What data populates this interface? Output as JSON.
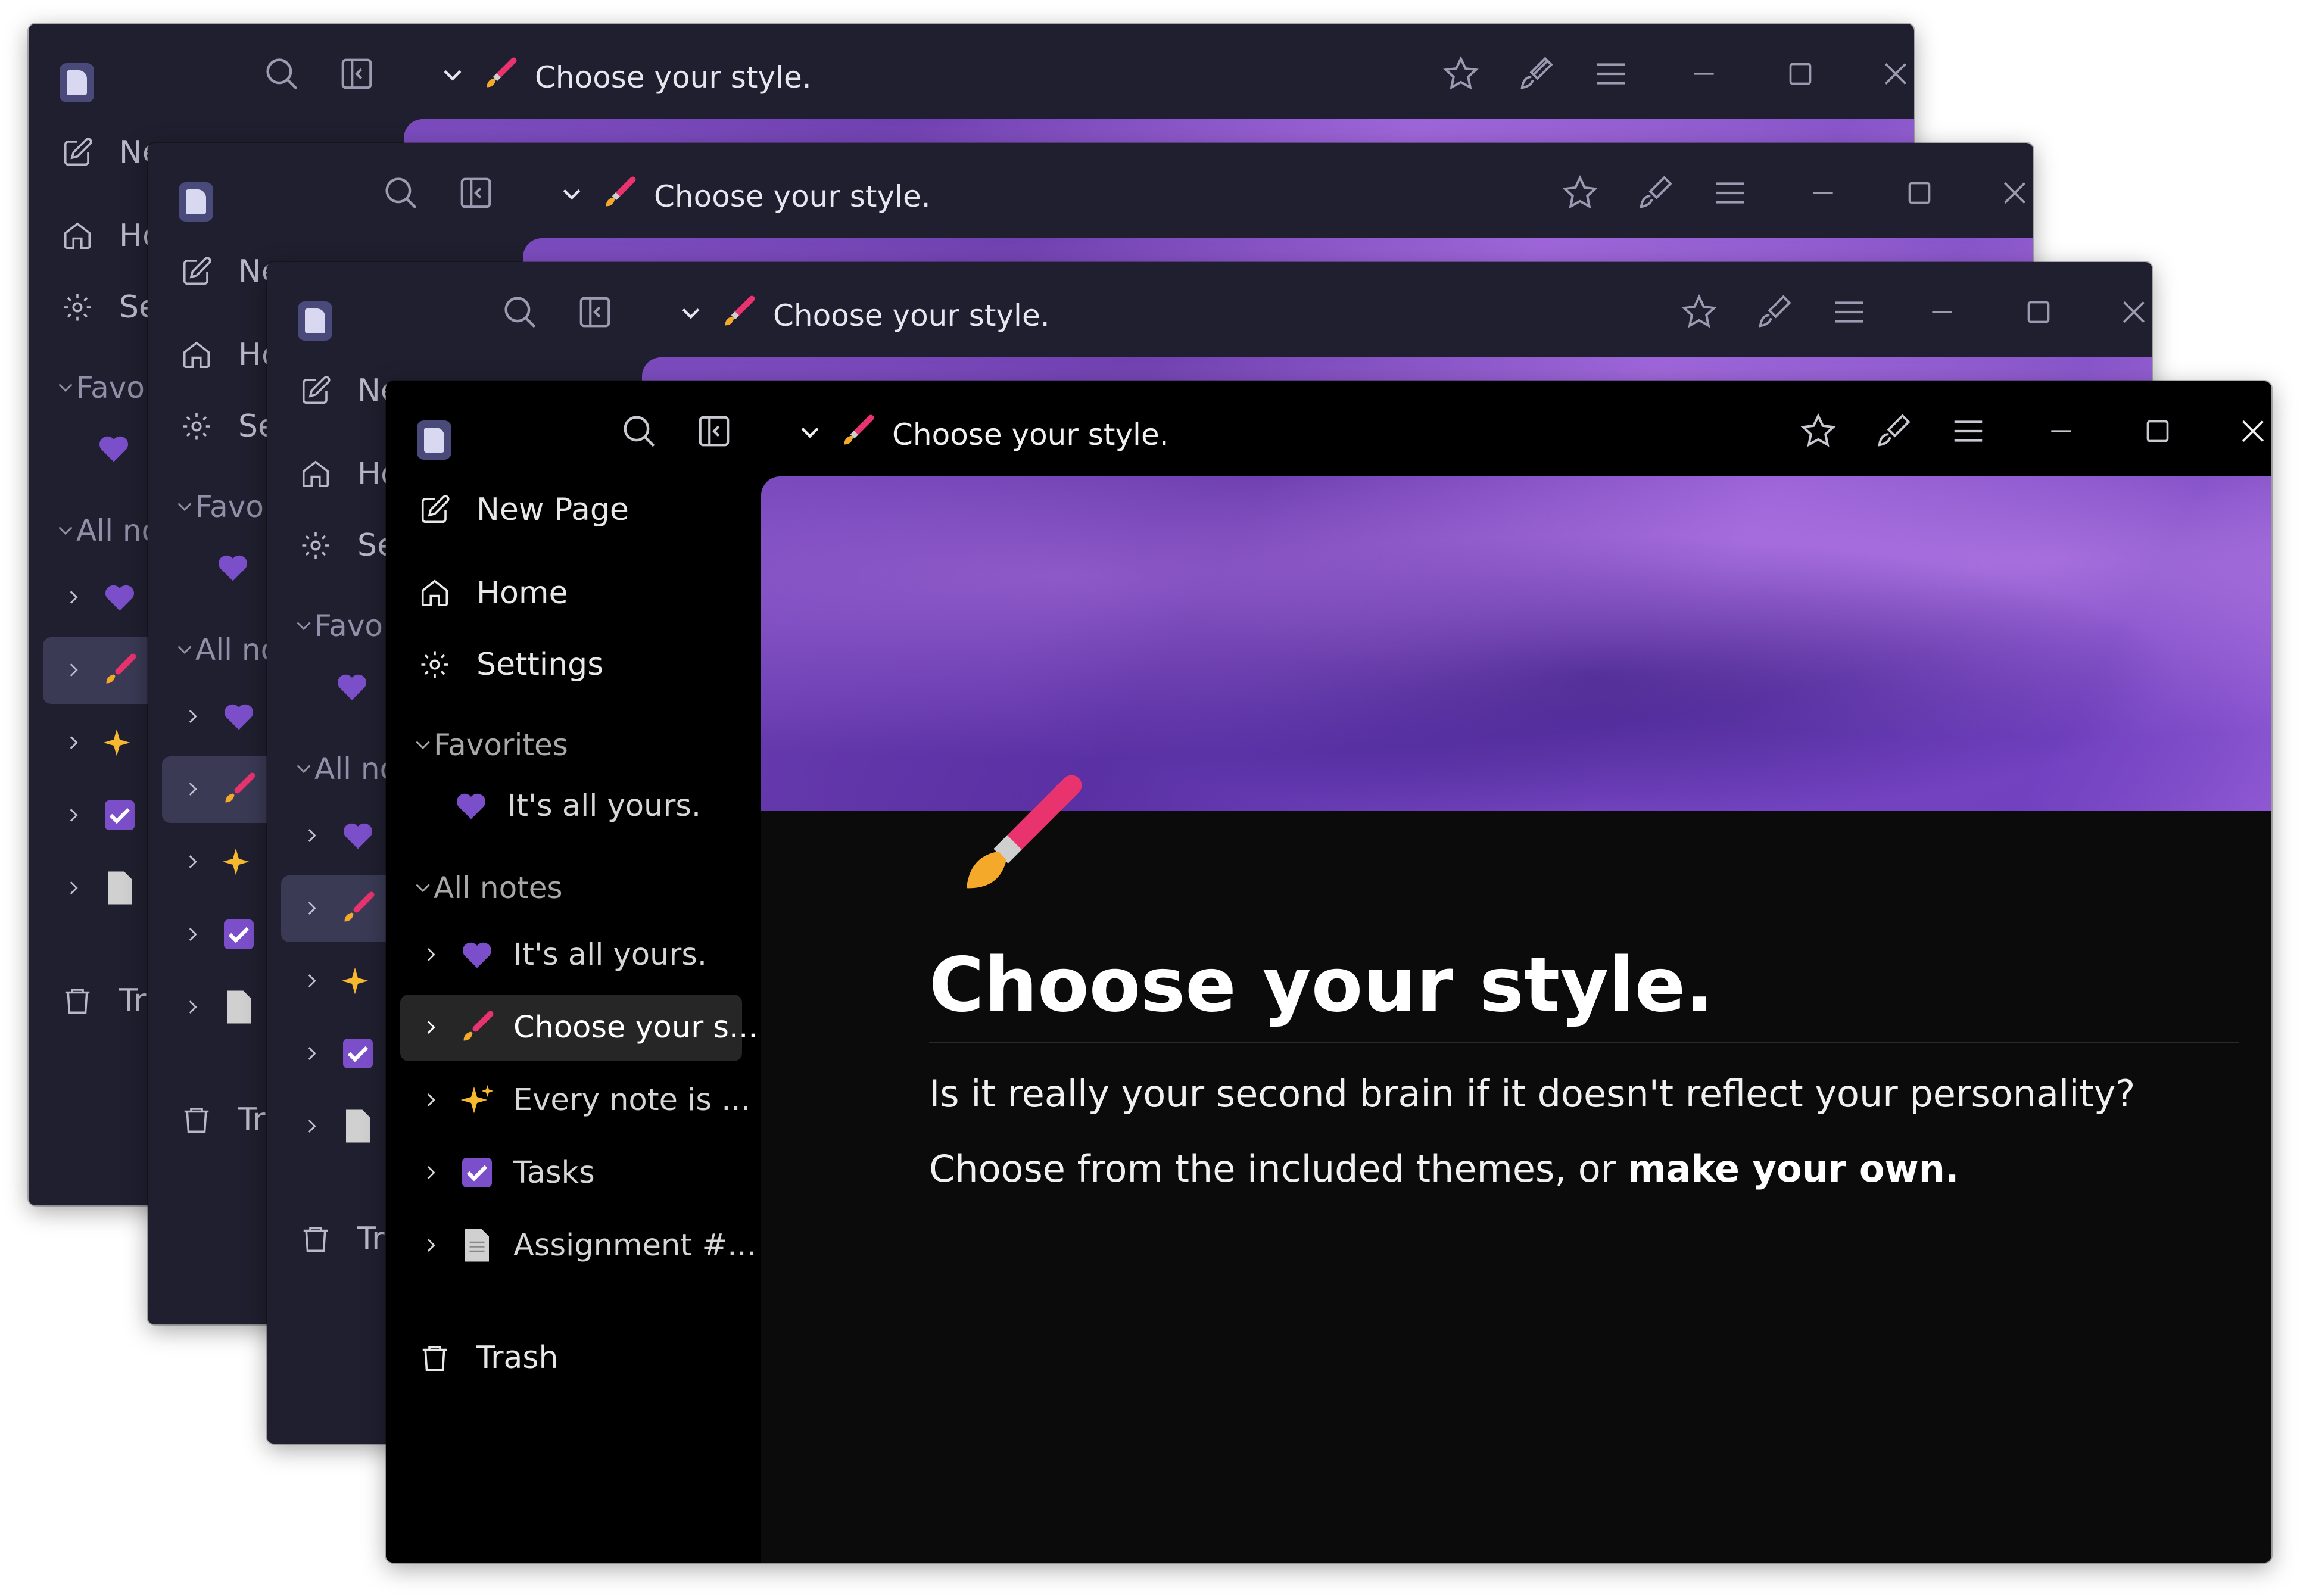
{
  "page": {
    "title": "Choose your style.",
    "heading": "Choose your style.",
    "paragraph1": "Is it really your second brain if it doesn't reflect your personality?",
    "paragraph2_plain": "Choose from the included themes, or ",
    "paragraph2_bold": "make your own."
  },
  "sidebar": {
    "new_page": "New Page",
    "home": "Home",
    "settings": "Settings",
    "favorites_header": "Favorites",
    "favorites": [
      {
        "label": "It's all yours.",
        "icon": "purple-heart"
      }
    ],
    "all_notes_header": "All notes",
    "notes": [
      {
        "label": "It's all yours.",
        "icon": "purple-heart"
      },
      {
        "label": "Choose your s...",
        "icon": "paintbrush",
        "selected": true
      },
      {
        "label": "Every note is ...",
        "icon": "sparkles"
      },
      {
        "label": "Tasks",
        "icon": "checkbox"
      },
      {
        "label": "Assignment #...",
        "icon": "page"
      }
    ],
    "trash": "Trash"
  },
  "back_windows": {
    "new_page": "Ne",
    "home": "Ho",
    "settings": "Se",
    "favorites": "Favo",
    "all_notes": "All no",
    "trash": "Tra"
  },
  "colors": {
    "accent_purple": "#7b4fc9",
    "back_window_bg": "#1f1f2f",
    "front_window_bg": "#000000",
    "brush_pink": "#e8336f"
  }
}
